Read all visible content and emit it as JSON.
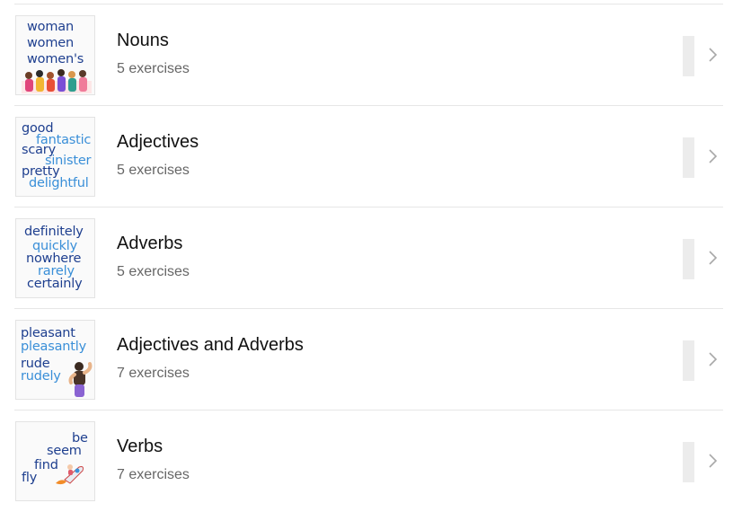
{
  "lessons": [
    {
      "title": "Nouns",
      "subtitle": "5 exercises"
    },
    {
      "title": "Adjectives",
      "subtitle": "5 exercises"
    },
    {
      "title": "Adverbs",
      "subtitle": "5 exercises"
    },
    {
      "title": "Adjectives and Adverbs",
      "subtitle": "7 exercises"
    },
    {
      "title": "Verbs",
      "subtitle": "7 exercises"
    }
  ],
  "thumbnails": {
    "nouns": [
      "woman",
      "women",
      "women's"
    ],
    "adjectives": [
      "good",
      "fantastic",
      "scary",
      "sinister",
      "pretty",
      "delightful"
    ],
    "adverbs": [
      "definitely",
      "quickly",
      "nowhere",
      "rarely",
      "certainly"
    ],
    "adj_adv": [
      "pleasant",
      "pleasantly",
      "rude",
      "rudely"
    ],
    "verbs": [
      "be",
      "seem",
      "find",
      "fly"
    ]
  },
  "colors": {
    "word_dark": "#1e3f8f",
    "word_light": "#3a8fd8",
    "title": "#111111",
    "subtitle": "#666666",
    "divider": "#e6e6e6"
  },
  "icons": {
    "row_action": "chevron-right-icon"
  }
}
